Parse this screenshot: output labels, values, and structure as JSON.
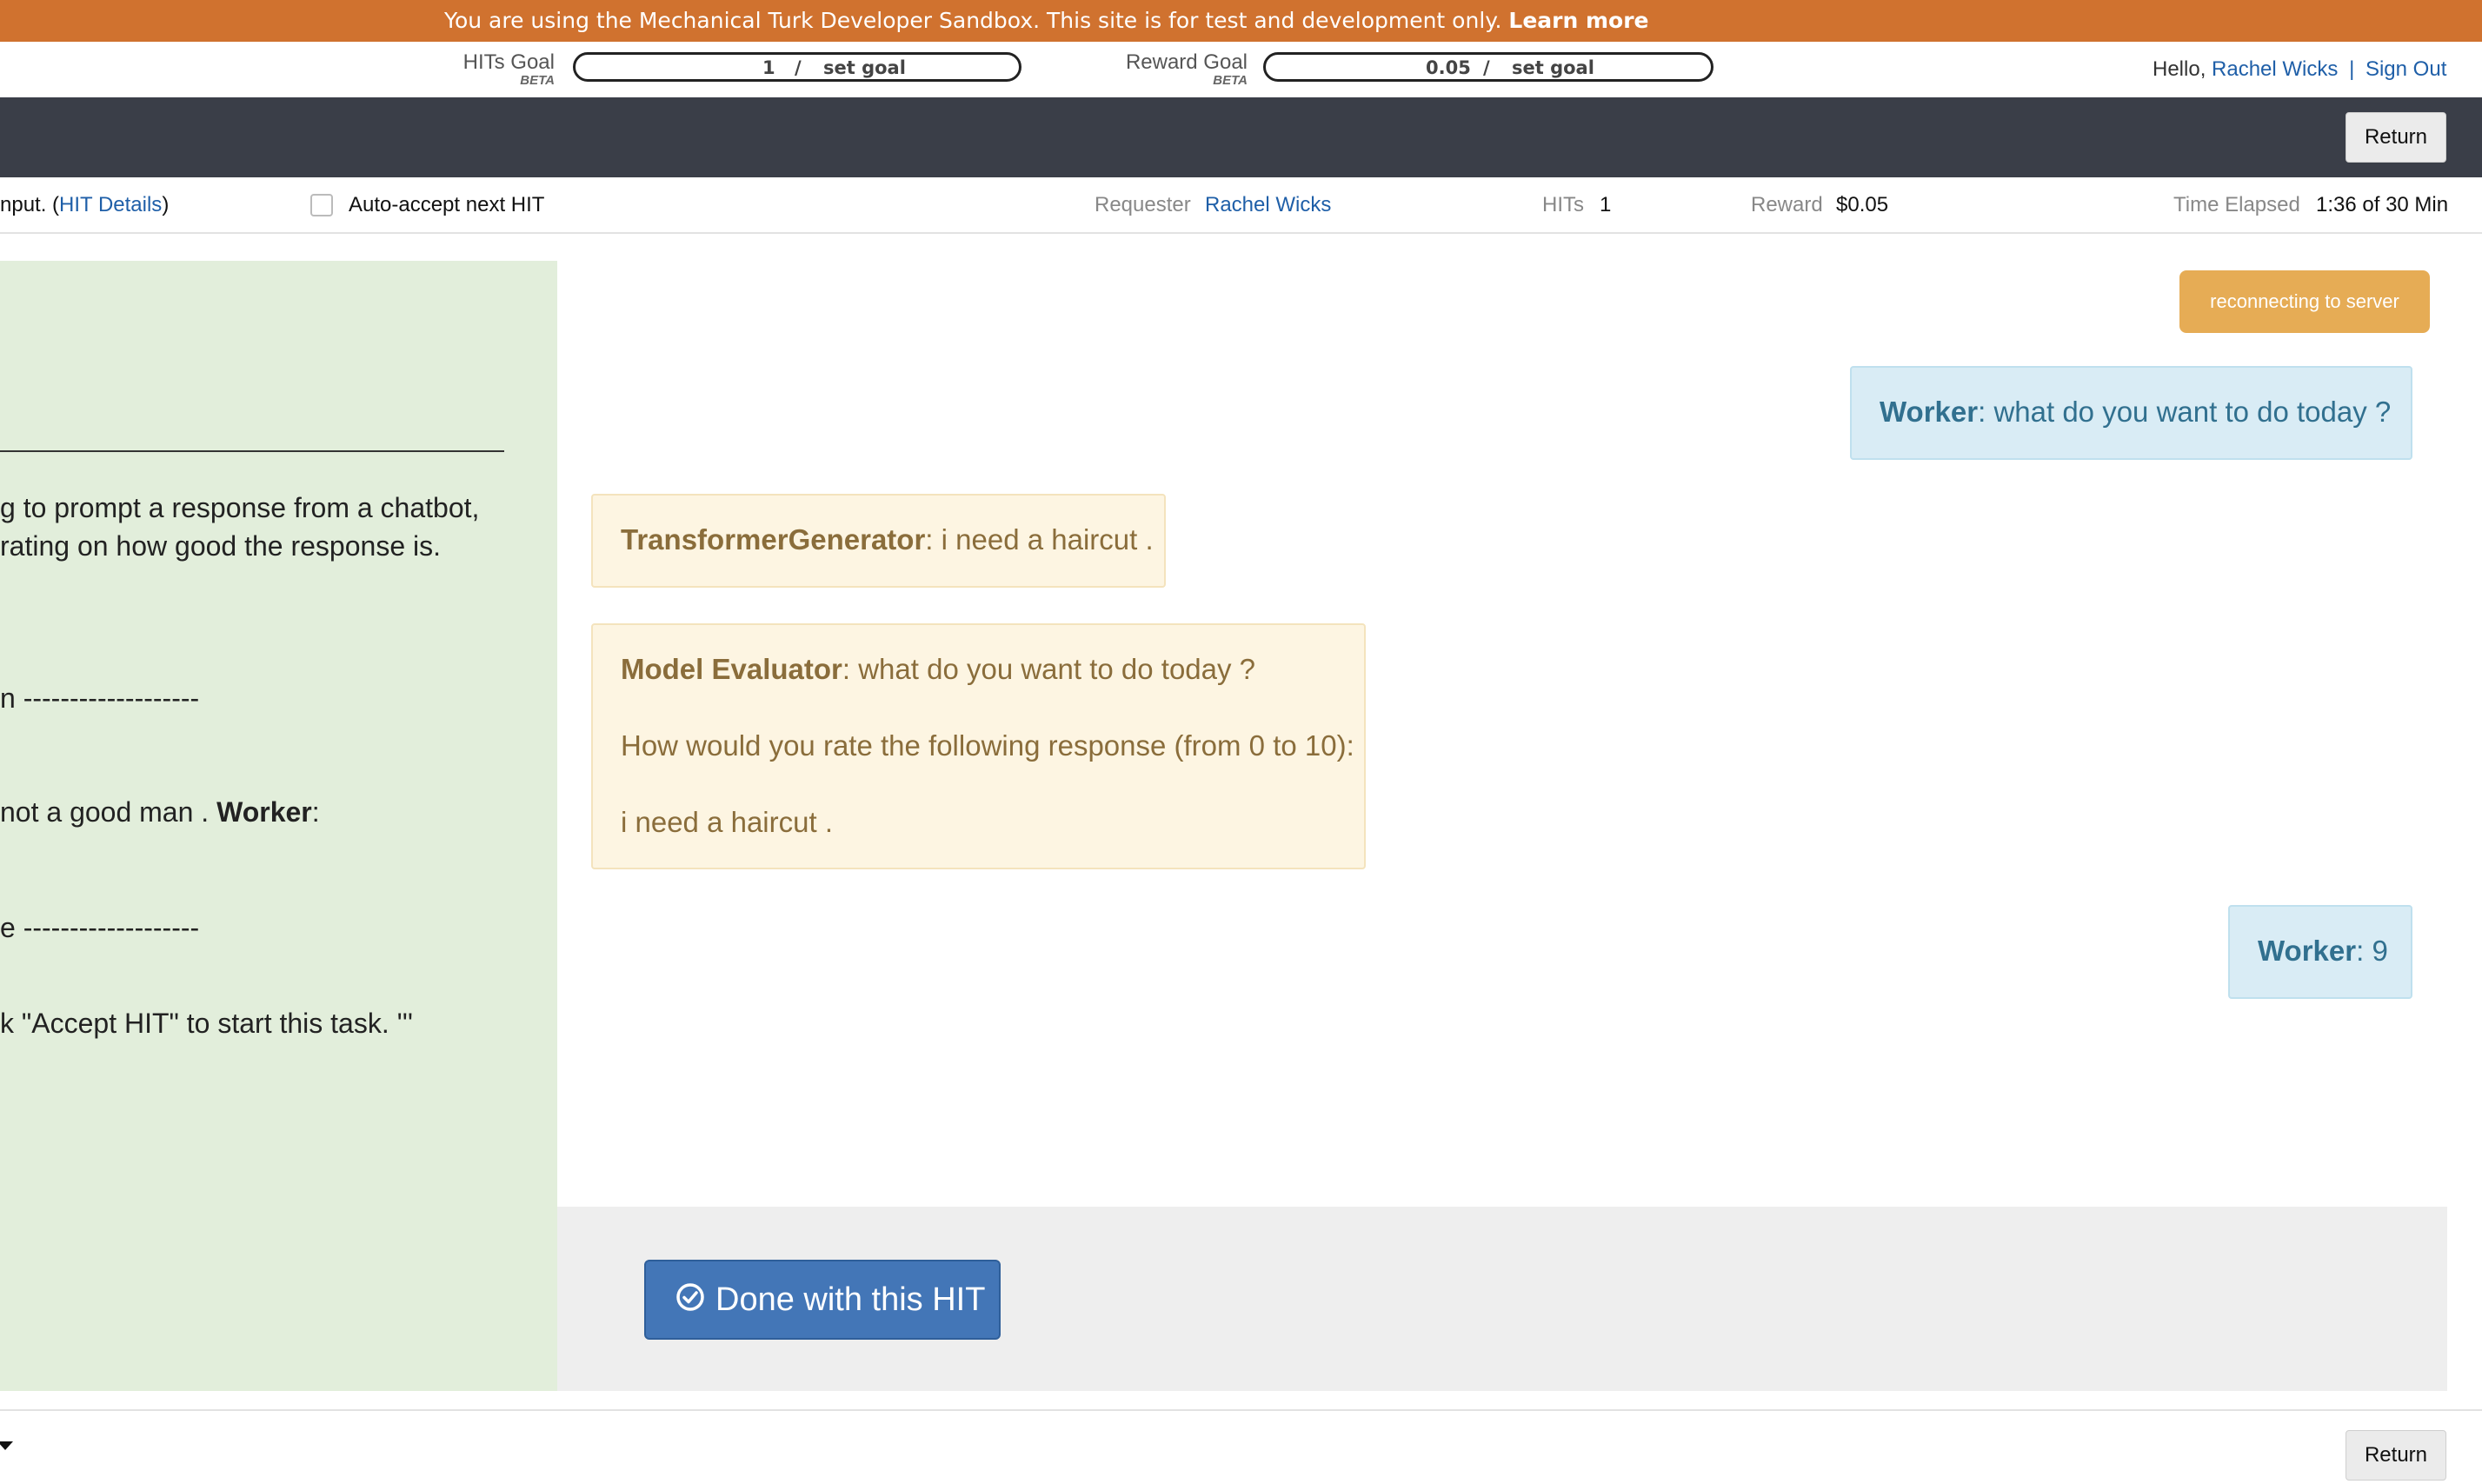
{
  "banner": {
    "text": "You are using the Mechanical Turk Developer Sandbox. This site is for test and development only.",
    "learn_more": "Learn more"
  },
  "goals": {
    "hits_goal_label": "HITs Goal",
    "hits_goal_beta": "BETA",
    "hits_goal_value": "1",
    "hits_goal_sep": "/",
    "hits_goal_set": "set goal",
    "reward_goal_label": "Reward Goal",
    "reward_goal_beta": "BETA",
    "reward_goal_value": "0.05",
    "reward_goal_sep": "/",
    "reward_goal_set": "set goal"
  },
  "user": {
    "hello": "Hello,",
    "name": "Rachel Wicks",
    "sep": "|",
    "sign_out": "Sign Out"
  },
  "toolbar": {
    "return_label": "Return"
  },
  "infobar": {
    "title_fragment": "nput. (",
    "hit_details": "HIT Details",
    "close_paren": ")",
    "auto_accept": "Auto-accept next HIT",
    "requester_label": "Requester",
    "requester_name": "Rachel Wicks",
    "hits_label": "HITs",
    "hits_value": "1",
    "reward_label": "Reward",
    "reward_value": "$0.05",
    "time_label": "Time Elapsed",
    "time_value": "1:36 of 30 Min"
  },
  "instructions": {
    "line1": "g to prompt a response from a chatbot,",
    "line2": " rating on how good the response is.",
    "line3": "n -------------------",
    "line4_pre": "not a good man . ",
    "line4_bold": "Worker",
    "line4_post": ":",
    "line5": "e -------------------",
    "line6": "k \"Accept HIT\" to start this task. '''"
  },
  "chat": {
    "status": "reconnecting to server",
    "messages": [
      {
        "speaker": "Worker",
        "text": ": what do you want to do today ?"
      },
      {
        "speaker": "TransformerGenerator",
        "text": ": i need a haircut ."
      },
      {
        "speaker": "Model Evaluator",
        "text": ": what do you want to do today ?",
        "line2": "How would you rate the following response (from 0 to 10):",
        "line3": "i need a haircut ."
      },
      {
        "speaker": "Worker",
        "text": ": 9"
      }
    ],
    "done_label": "Done with this HIT"
  },
  "footer": {
    "return_label": "Return"
  },
  "colors": {
    "banner": "#d0722f",
    "dark_bar": "#3a3e48",
    "instruction_panel": "#e2eedb",
    "worker_bubble": "#d9ecf5",
    "model_bubble": "#fdf5e2",
    "status_badge": "#e6ac55",
    "primary_button": "#4376b7",
    "link": "#1f5fa8"
  }
}
